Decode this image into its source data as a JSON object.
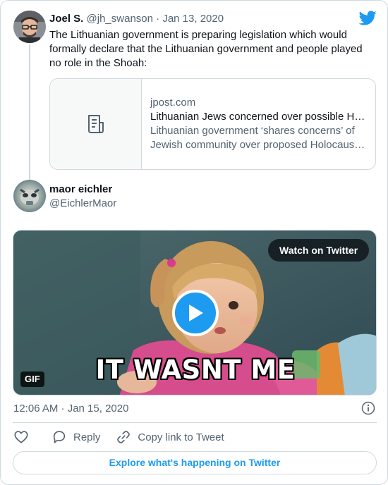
{
  "quoted_tweet": {
    "display_name": "Joel S.",
    "handle": "@jh_swanson",
    "separator": "·",
    "date": "Jan 13, 2020",
    "text": "The Lithuanian government is preparing legislation which would formally declare that the Lithuanian government and people played no role in the Shoah:",
    "link_card": {
      "domain": "jpost.com",
      "title": "Lithuanian Jews concerned over possible H…",
      "description": "Lithuanian government ‘shares concerns’ of Jewish community over proposed Holocaus…",
      "icon": "document-icon"
    }
  },
  "tweet": {
    "display_name": "maor eichler",
    "handle": "@EichlerMaor",
    "media": {
      "type": "GIF",
      "badge": "GIF",
      "caption": "IT WASNT ME",
      "watch_button": "Watch on Twitter"
    },
    "timestamp": "12:06 AM · Jan 15, 2020"
  },
  "actions": {
    "like_icon": "heart-icon",
    "reply_label": "Reply",
    "copy_label": "Copy link to Tweet"
  },
  "footer": {
    "explore_label": "Explore what's happening on Twitter"
  },
  "colors": {
    "accent": "#1d9bf0",
    "text": "#0f1419",
    "secondary": "#536471",
    "border": "#cfd9de"
  }
}
